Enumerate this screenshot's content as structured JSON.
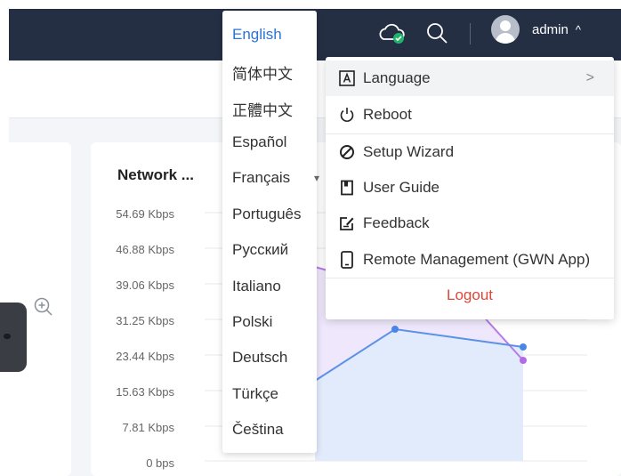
{
  "header": {
    "user": "admin",
    "colors": {
      "bar": "#252f44",
      "accent": "#2b75d6",
      "ok": "#22b36a"
    }
  },
  "network_card": {
    "title": "Network ...",
    "y_ticks": [
      "54.69 Kbps",
      "46.88 Kbps",
      "39.06 Kbps",
      "31.25 Kbps",
      "23.44 Kbps",
      "15.63 Kbps",
      "7.81 Kbps",
      "0 bps"
    ]
  },
  "language_menu": {
    "items": [
      "English",
      "简体中文",
      "正體中文",
      "Español",
      "Français",
      "Português",
      "Русский",
      "Italiano",
      "Polski",
      "Deutsch",
      "Türkçe",
      "Čeština"
    ],
    "selected": "English"
  },
  "user_menu": {
    "items": [
      {
        "label": "Language",
        "icon": "language-icon"
      },
      {
        "label": "Reboot",
        "icon": "power-icon"
      },
      {
        "label": "Setup Wizard",
        "icon": "wizard-icon"
      },
      {
        "label": "User Guide",
        "icon": "book-icon"
      },
      {
        "label": "Feedback",
        "icon": "feedback-icon"
      },
      {
        "label": "Remote Management (GWN App)",
        "icon": "phone-icon"
      }
    ],
    "logout": "Logout"
  }
}
